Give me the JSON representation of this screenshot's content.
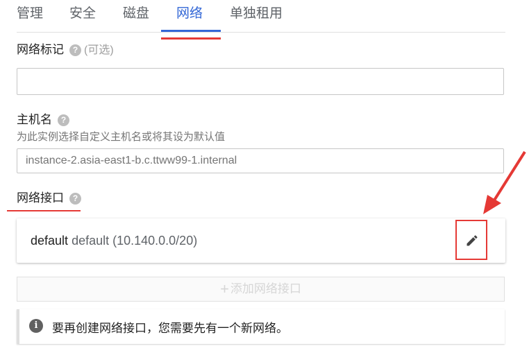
{
  "tabs": [
    {
      "label": "管理"
    },
    {
      "label": "安全"
    },
    {
      "label": "磁盘"
    },
    {
      "label": "网络"
    },
    {
      "label": "单独租用"
    }
  ],
  "active_tab": "网络",
  "network_tags": {
    "label": "网络标记",
    "optional": "(可选)",
    "value": ""
  },
  "hostname": {
    "label": "主机名",
    "hint": "为此实例选择自定义主机名或将其设为默认值",
    "placeholder": "instance-2.asia-east1-b.c.ttww99-1.internal"
  },
  "network_interfaces": {
    "label": "网络接口",
    "items": [
      {
        "name": "default",
        "detail": "default (10.140.0.0/20)"
      }
    ],
    "add_label": "添加网络接口",
    "info": "要再创建网络接口，您需要先有一个新网络。"
  },
  "icons": {
    "help": "help-icon",
    "edit": "pencil-icon",
    "info": "info-icon",
    "add": "plus-icon"
  },
  "colors": {
    "accent": "#3367d6",
    "annotation": "#e53935"
  }
}
